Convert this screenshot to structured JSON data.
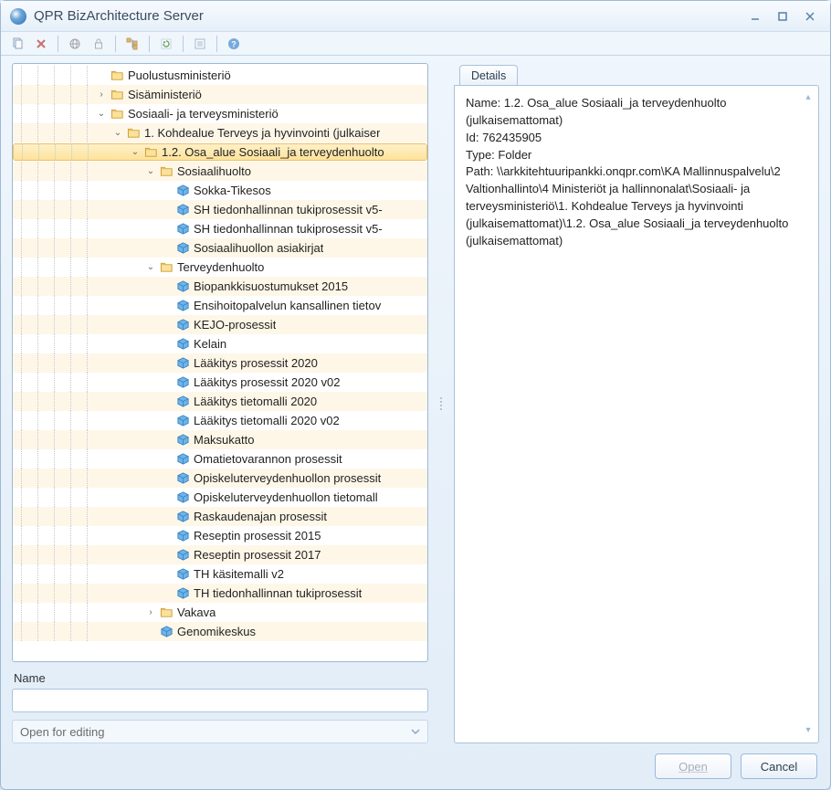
{
  "window": {
    "title": "QPR BizArchitecture Server"
  },
  "toolbar_icons": [
    "copy",
    "delete",
    "globe",
    "lock",
    "tree",
    "refresh",
    "props",
    "help"
  ],
  "tree": [
    {
      "depth": 5,
      "type": "folder",
      "toggle": "",
      "label": "Puolustusministeriö"
    },
    {
      "depth": 5,
      "type": "folder",
      "toggle": "closed",
      "label": "Sisäministeriö"
    },
    {
      "depth": 5,
      "type": "folder",
      "toggle": "open",
      "label": "Sosiaali- ja terveysministeriö"
    },
    {
      "depth": 6,
      "type": "folder",
      "toggle": "open",
      "label": "1. Kohdealue Terveys ja hyvinvointi (julkaiser"
    },
    {
      "depth": 7,
      "type": "folder",
      "toggle": "open",
      "label": "1.2. Osa_alue Sosiaali_ja terveydenhuolto",
      "selected": true
    },
    {
      "depth": 8,
      "type": "folder",
      "toggle": "open",
      "label": "Sosiaalihuolto"
    },
    {
      "depth": 9,
      "type": "model",
      "toggle": "",
      "label": "Sokka-Tikesos"
    },
    {
      "depth": 9,
      "type": "model",
      "toggle": "",
      "label": "SH tiedonhallinnan tukiprosessit v5-"
    },
    {
      "depth": 9,
      "type": "model",
      "toggle": "",
      "label": "SH tiedonhallinnan tukiprosessit v5-"
    },
    {
      "depth": 9,
      "type": "model",
      "toggle": "",
      "label": "Sosiaalihuollon asiakirjat"
    },
    {
      "depth": 8,
      "type": "folder",
      "toggle": "open",
      "label": "Terveydenhuolto"
    },
    {
      "depth": 9,
      "type": "model",
      "toggle": "",
      "label": "Biopankkisuostumukset 2015"
    },
    {
      "depth": 9,
      "type": "model",
      "toggle": "",
      "label": "Ensihoitopalvelun kansallinen tietov"
    },
    {
      "depth": 9,
      "type": "model",
      "toggle": "",
      "label": "KEJO-prosessit"
    },
    {
      "depth": 9,
      "type": "model",
      "toggle": "",
      "label": "Kelain"
    },
    {
      "depth": 9,
      "type": "model",
      "toggle": "",
      "label": "Lääkitys prosessit 2020"
    },
    {
      "depth": 9,
      "type": "model",
      "toggle": "",
      "label": "Lääkitys prosessit 2020 v02"
    },
    {
      "depth": 9,
      "type": "model",
      "toggle": "",
      "label": "Lääkitys tietomalli 2020"
    },
    {
      "depth": 9,
      "type": "model",
      "toggle": "",
      "label": "Lääkitys tietomalli 2020 v02"
    },
    {
      "depth": 9,
      "type": "model",
      "toggle": "",
      "label": "Maksukatto"
    },
    {
      "depth": 9,
      "type": "model",
      "toggle": "",
      "label": "Omatietovarannon prosessit"
    },
    {
      "depth": 9,
      "type": "model",
      "toggle": "",
      "label": "Opiskeluterveydenhuollon prosessit"
    },
    {
      "depth": 9,
      "type": "model",
      "toggle": "",
      "label": "Opiskeluterveydenhuollon tietomall"
    },
    {
      "depth": 9,
      "type": "model",
      "toggle": "",
      "label": "Raskaudenajan prosessit"
    },
    {
      "depth": 9,
      "type": "model",
      "toggle": "",
      "label": "Reseptin prosessit 2015"
    },
    {
      "depth": 9,
      "type": "model",
      "toggle": "",
      "label": "Reseptin prosessit 2017"
    },
    {
      "depth": 9,
      "type": "model",
      "toggle": "",
      "label": "TH käsitemalli v2"
    },
    {
      "depth": 9,
      "type": "model",
      "toggle": "",
      "label": "TH tiedonhallinnan tukiprosessit"
    },
    {
      "depth": 8,
      "type": "folder",
      "toggle": "closed",
      "label": "Vakava"
    },
    {
      "depth": 8,
      "type": "model",
      "toggle": "",
      "label": "Genomikeskus"
    }
  ],
  "name_field": {
    "label": "Name",
    "value": ""
  },
  "action_select": {
    "value": "Open for editing"
  },
  "details": {
    "tab": "Details",
    "name": "Name: 1.2. Osa_alue Sosiaali_ja terveydenhuolto (julkaisemattomat)",
    "id": "Id: 762435905",
    "type": "Type: Folder",
    "path": "Path: \\\\arkkitehtuuripankki.onqpr.com\\KA Mallinnuspalvelu\\2 Valtionhallinto\\4 Ministeriöt ja hallinnonalat\\Sosiaali- ja terveysministeriö\\1. Kohdealue Terveys ja hyvinvointi (julkaisemattomat)\\1.2. Osa_alue Sosiaali_ja terveydenhuolto (julkaisemattomat)"
  },
  "footer": {
    "open": "Open",
    "cancel": "Cancel"
  }
}
